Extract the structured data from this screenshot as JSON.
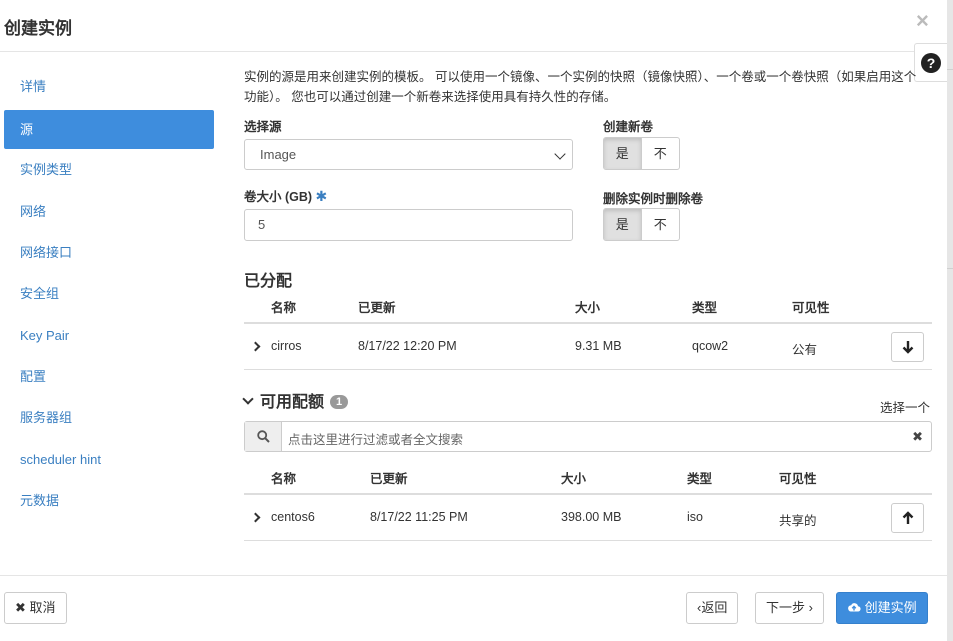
{
  "modal": {
    "title": "创建实例",
    "close": "×",
    "help": "?"
  },
  "sidebar": {
    "items": [
      {
        "label": "详情"
      },
      {
        "label": "源"
      },
      {
        "label": "实例类型"
      },
      {
        "label": "网络"
      },
      {
        "label": "网络接口"
      },
      {
        "label": "安全组"
      },
      {
        "label": "Key Pair"
      },
      {
        "label": "配置"
      },
      {
        "label": "服务器组"
      },
      {
        "label": "scheduler hint"
      },
      {
        "label": "元数据"
      }
    ],
    "active": "源"
  },
  "source": {
    "description": "实例的源是用来创建实例的模板。 可以使用一个镜像、一个实例的快照（镜像快照）、一个卷或一个卷快照（如果启用这个功能）。 您也可以通过创建一个新卷来选择使用具有持久性的存储。",
    "select_source_label": "选择源",
    "select_source_value": "Image",
    "volume_size_label": "卷大小 (GB)",
    "required_mark": "✱",
    "volume_size_value": "5",
    "create_volume_label": "创建新卷",
    "delete_volume_label": "删除实例时删除卷",
    "yes": "是",
    "no": "不"
  },
  "allocated": {
    "title": "已分配",
    "headers": {
      "name": "名称",
      "updated": "已更新",
      "size": "大小",
      "type": "类型",
      "visibility": "可见性"
    },
    "rows": [
      {
        "name": "cirros",
        "updated": "8/17/22 12:20 PM",
        "size": "9.31 MB",
        "type": "qcow2",
        "visibility": "公有"
      }
    ]
  },
  "available": {
    "title": "可用配额",
    "count": "1",
    "pick_one": "选择一个",
    "filter_placeholder": "点击这里进行过滤或者全文搜索",
    "headers": {
      "name": "名称",
      "updated": "已更新",
      "size": "大小",
      "type": "类型",
      "visibility": "可见性"
    },
    "rows": [
      {
        "name": "centos6",
        "updated": "8/17/22 11:25 PM",
        "size": "398.00 MB",
        "type": "iso",
        "visibility": "共享的"
      }
    ]
  },
  "footer": {
    "cancel": "取消",
    "back": "返回",
    "next": "下一步",
    "create": "创建实例"
  },
  "colors": {
    "accent": "#3e8ddd",
    "link": "#3a7fc1"
  }
}
